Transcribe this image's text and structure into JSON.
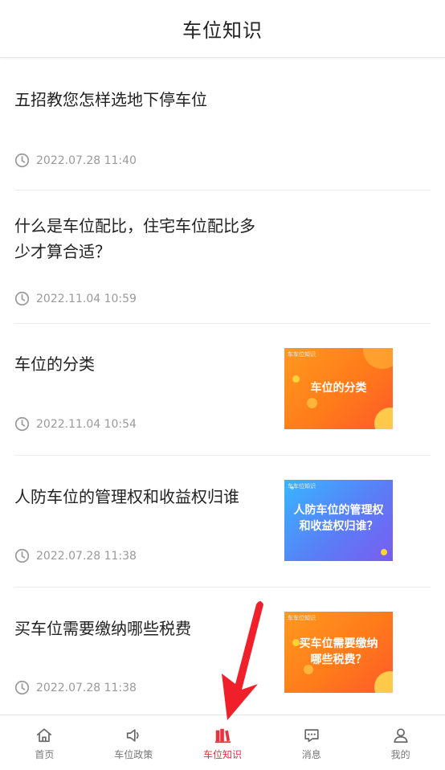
{
  "header": {
    "title": "车位知识"
  },
  "articles": [
    {
      "title_lines": [
        "五招教您怎样选地下停车位"
      ],
      "time": "2022.07.28 11:40"
    },
    {
      "title_lines": [
        "什么是车位配比，住宅车位配比多",
        "少才算合适？"
      ],
      "time": "2022.11.04 10:59"
    },
    {
      "title_lines": [
        "车位的分类"
      ],
      "time": "2022.11.04 10:54",
      "thumb": {
        "tag": "车车位知识",
        "caption_lines": [
          "车位的分类"
        ]
      }
    },
    {
      "title_lines": [
        "人防车位的管理权和收益权归谁"
      ],
      "time": "2022.07.28 11:38",
      "thumb": {
        "tag": "车车位知识",
        "caption_lines": [
          "人防车位的管理权",
          "和收益权归谁？"
        ]
      }
    },
    {
      "title_lines": [
        "买车位需要缴纳哪些税费"
      ],
      "time": "2022.07.28 11:38",
      "thumb": {
        "tag": "车车位知识",
        "caption_lines": [
          "买车位需要缴纳",
          "哪些税费？"
        ]
      }
    }
  ],
  "tabbar": {
    "active_color": "#e8323c",
    "items": [
      {
        "label": "首页",
        "icon": "home-icon"
      },
      {
        "label": "车位政策",
        "icon": "megaphone-icon"
      },
      {
        "label": "车位知识",
        "icon": "book-icon",
        "active": true
      },
      {
        "label": "消息",
        "icon": "message-icon"
      },
      {
        "label": "我的",
        "icon": "user-icon"
      }
    ]
  },
  "annotation": {
    "type": "arrow",
    "color": "#f0202a",
    "points_to": "tab-knowledge"
  }
}
